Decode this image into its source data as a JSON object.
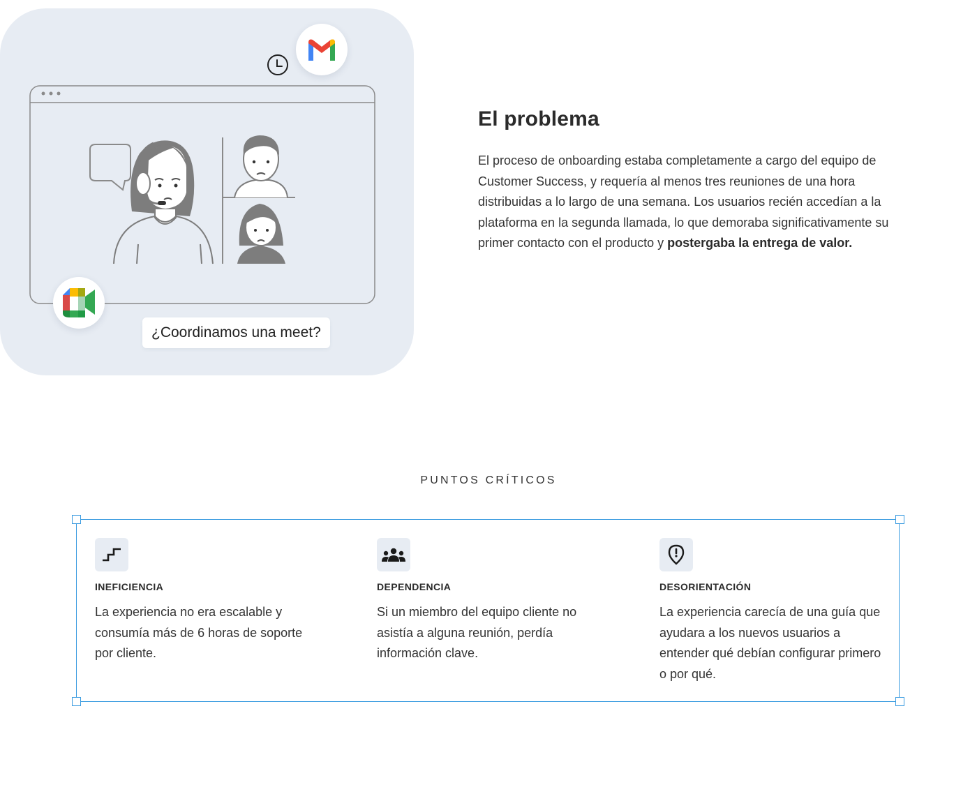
{
  "illustration": {
    "bubble_text": "¿Coordinamos una meet?",
    "icons": [
      "clock-icon",
      "gmail-icon",
      "google-meet-icon",
      "speech-bubble-icon"
    ],
    "colors": {
      "background": "#e7ecf3",
      "line": "#8a8a8a",
      "fill": "#7d7d7d"
    }
  },
  "problem": {
    "title": "El problema",
    "body": "El proceso de onboarding estaba completamente a cargo del equipo de Customer Success, y requería al menos tres reuniones de una hora distribuidas a lo largo de una semana. Los usuarios recién accedían a la plataforma en la segunda llamada, lo que demoraba significativamente su primer contacto con el producto y ",
    "body_emphasis": "postergaba la entrega de valor."
  },
  "critical": {
    "title": "PUNTOS CRÍTICOS",
    "selection_color": "#3a9be0",
    "items": [
      {
        "icon": "stairs-icon",
        "heading": "INEFICIENCIA",
        "text": "La experiencia no era escalable y consumía más de 6 horas de soporte por cliente."
      },
      {
        "icon": "group-icon",
        "heading": "DEPENDENCIA",
        "text": "Si un miembro del equipo cliente no asistía a alguna reunión, perdía información clave."
      },
      {
        "icon": "location-alert-icon",
        "heading": "DESORIENTACIÓN",
        "text": "La experiencia carecía de una guía que ayudara a los nuevos usuarios a entender qué debían configurar primero o por qué."
      }
    ]
  }
}
